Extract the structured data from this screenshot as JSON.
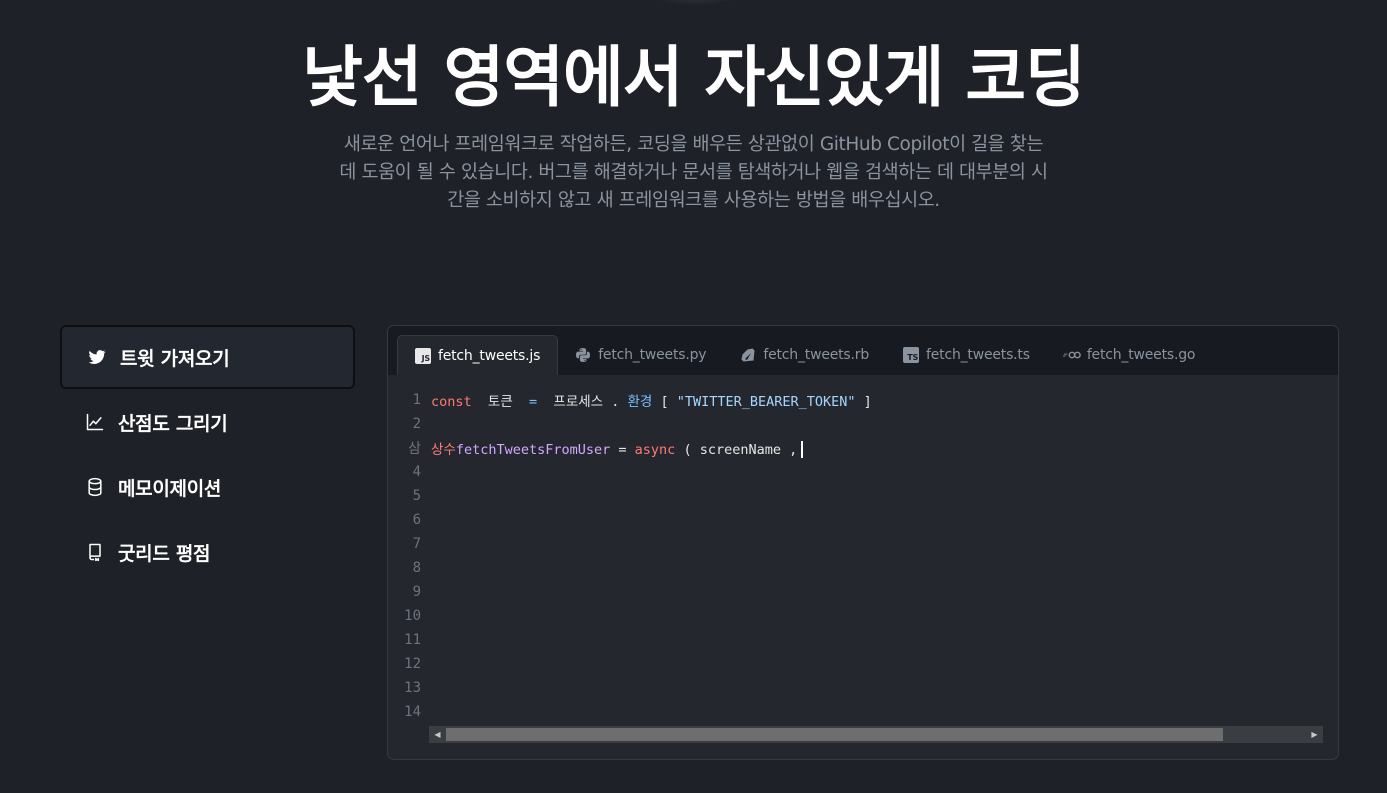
{
  "hero": {
    "title": "낯선 영역에서 자신있게 코딩",
    "description": "새로운 언어나 프레임워크로 작업하든, 코딩을 배우든 상관없이 GitHub Copilot이 길을 찾는 데 도움이 될 수 있습니다. 버그를 해결하거나 문서를 탐색하거나 웹을 검색하는 데 대부분의 시간을 소비하지 않고 새 프레임워크를 사용하는 방법을 배우십시오."
  },
  "sidebar": {
    "items": [
      {
        "label": "트윗 가져오기",
        "icon": "twitter-icon",
        "active": true
      },
      {
        "label": "산점도 그리기",
        "icon": "chart-line-icon",
        "active": false
      },
      {
        "label": "메모이제이션",
        "icon": "database-icon",
        "active": false
      },
      {
        "label": "굿리드 평점",
        "icon": "book-icon",
        "active": false
      }
    ]
  },
  "editor": {
    "tabs": [
      {
        "label": "fetch_tweets.js",
        "icon": "javascript-icon",
        "active": true
      },
      {
        "label": "fetch_tweets.py",
        "icon": "python-icon",
        "active": false
      },
      {
        "label": "fetch_tweets.rb",
        "icon": "ruby-icon",
        "active": false
      },
      {
        "label": "fetch_tweets.ts",
        "icon": "typescript-icon",
        "active": false
      },
      {
        "label": "fetch_tweets.go",
        "icon": "go-icon",
        "active": false
      }
    ],
    "lines": [
      {
        "n": "1",
        "tokens": [
          {
            "t": "const",
            "c": "kw"
          },
          {
            "t": "  토큰  ",
            "c": ""
          },
          {
            "t": "=",
            "c": "op"
          },
          {
            "t": "  프로세스 . ",
            "c": ""
          },
          {
            "t": "환경",
            "c": "op"
          },
          {
            "t": " [ ",
            "c": ""
          },
          {
            "t": "\"TWITTER_BEARER_TOKEN\"",
            "c": "str"
          },
          {
            "t": " ]",
            "c": ""
          }
        ]
      },
      {
        "n": "2",
        "tokens": []
      },
      {
        "n": "삼",
        "tokens": [
          {
            "t": "상수",
            "c": "kw"
          },
          {
            "t": "fetchTweetsFromUser",
            "c": "fn"
          },
          {
            "t": " = ",
            "c": ""
          },
          {
            "t": "async",
            "c": "kw"
          },
          {
            "t": " ( screenName ,",
            "c": ""
          }
        ],
        "cursor": true
      },
      {
        "n": "4",
        "tokens": []
      },
      {
        "n": "5",
        "tokens": []
      },
      {
        "n": "6",
        "tokens": []
      },
      {
        "n": "7",
        "tokens": []
      },
      {
        "n": "8",
        "tokens": []
      },
      {
        "n": "9",
        "tokens": []
      },
      {
        "n": "10",
        "tokens": []
      },
      {
        "n": "11",
        "tokens": []
      },
      {
        "n": "12",
        "tokens": []
      },
      {
        "n": "13",
        "tokens": []
      },
      {
        "n": "14",
        "tokens": []
      }
    ],
    "scrollbar": {
      "left_arrow": "◀",
      "right_arrow": "▶"
    }
  },
  "colors": {
    "background": "#1e2128",
    "keyword": "#ff7b72",
    "function": "#d2a8ff",
    "string": "#a5d6ff",
    "operator": "#79c0ff",
    "js_badge": "#f1e05a",
    "ts_badge": "#3178c6"
  }
}
